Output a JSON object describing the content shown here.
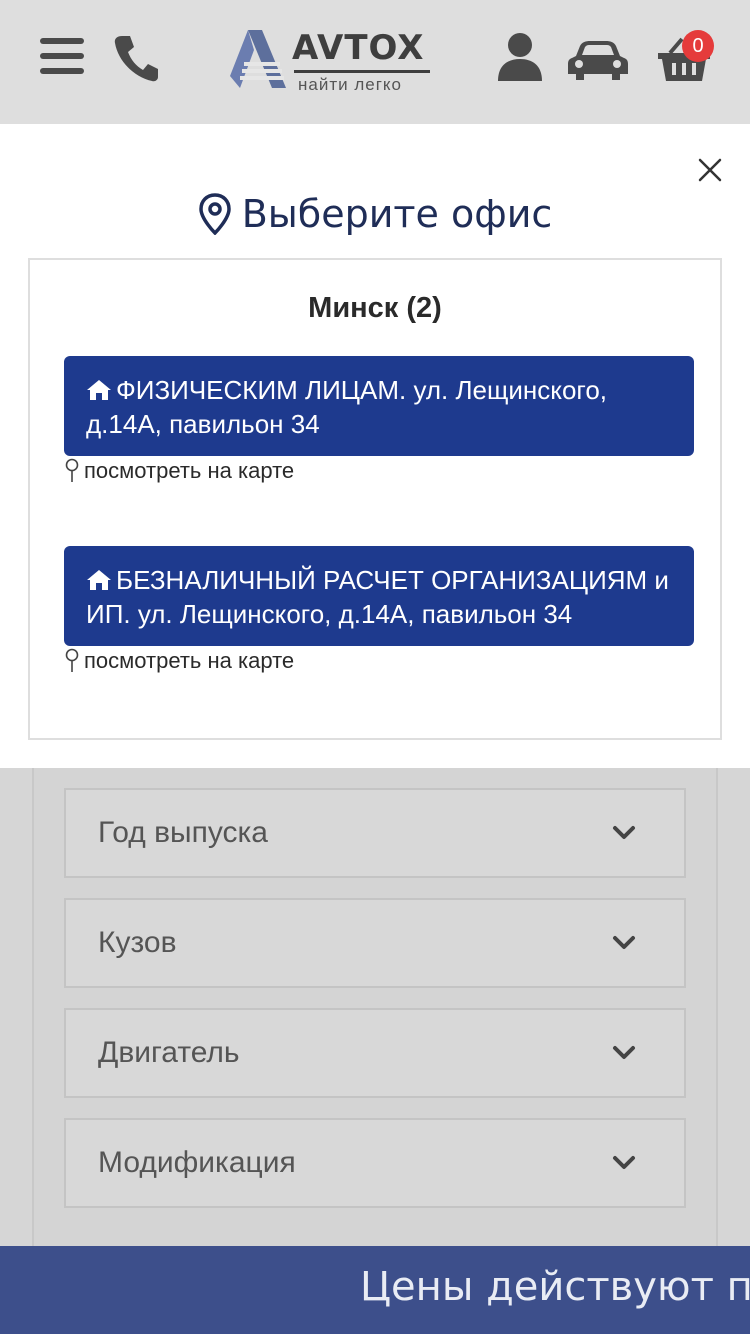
{
  "header": {
    "logo": {
      "name": "AVTOX",
      "tagline": "найти легко"
    },
    "cart_count": "0",
    "icons": [
      "menu-icon",
      "phone-icon",
      "user-icon",
      "car-icon",
      "cart-icon"
    ]
  },
  "modal": {
    "title": "Выберите офис",
    "city": "Минск (2)",
    "offices": [
      {
        "label": "ФИЗИЧЕСКИМ ЛИЦАМ. ул. Лещинского, д.14А, павильон 34",
        "map_link": "посмотреть на карте"
      },
      {
        "label": "БЕЗНАЛИЧНЫЙ РАСЧЕТ ОРГАНИЗАЦИЯМ и ИП. ул. Лещинского, д.14А, павильон 34",
        "map_link": "посмотреть на карте"
      }
    ]
  },
  "form": {
    "fields": [
      {
        "label": "Год выпуска"
      },
      {
        "label": "Кузов"
      },
      {
        "label": "Двигатель"
      },
      {
        "label": "Модификация"
      }
    ]
  },
  "banner": {
    "text": "Цены действуют пр"
  },
  "colors": {
    "accent_blue": "#1e3a8e",
    "title_navy": "#1f2d57",
    "badge_red": "#e53b3b",
    "banner_blue": "#3d4f8b"
  }
}
